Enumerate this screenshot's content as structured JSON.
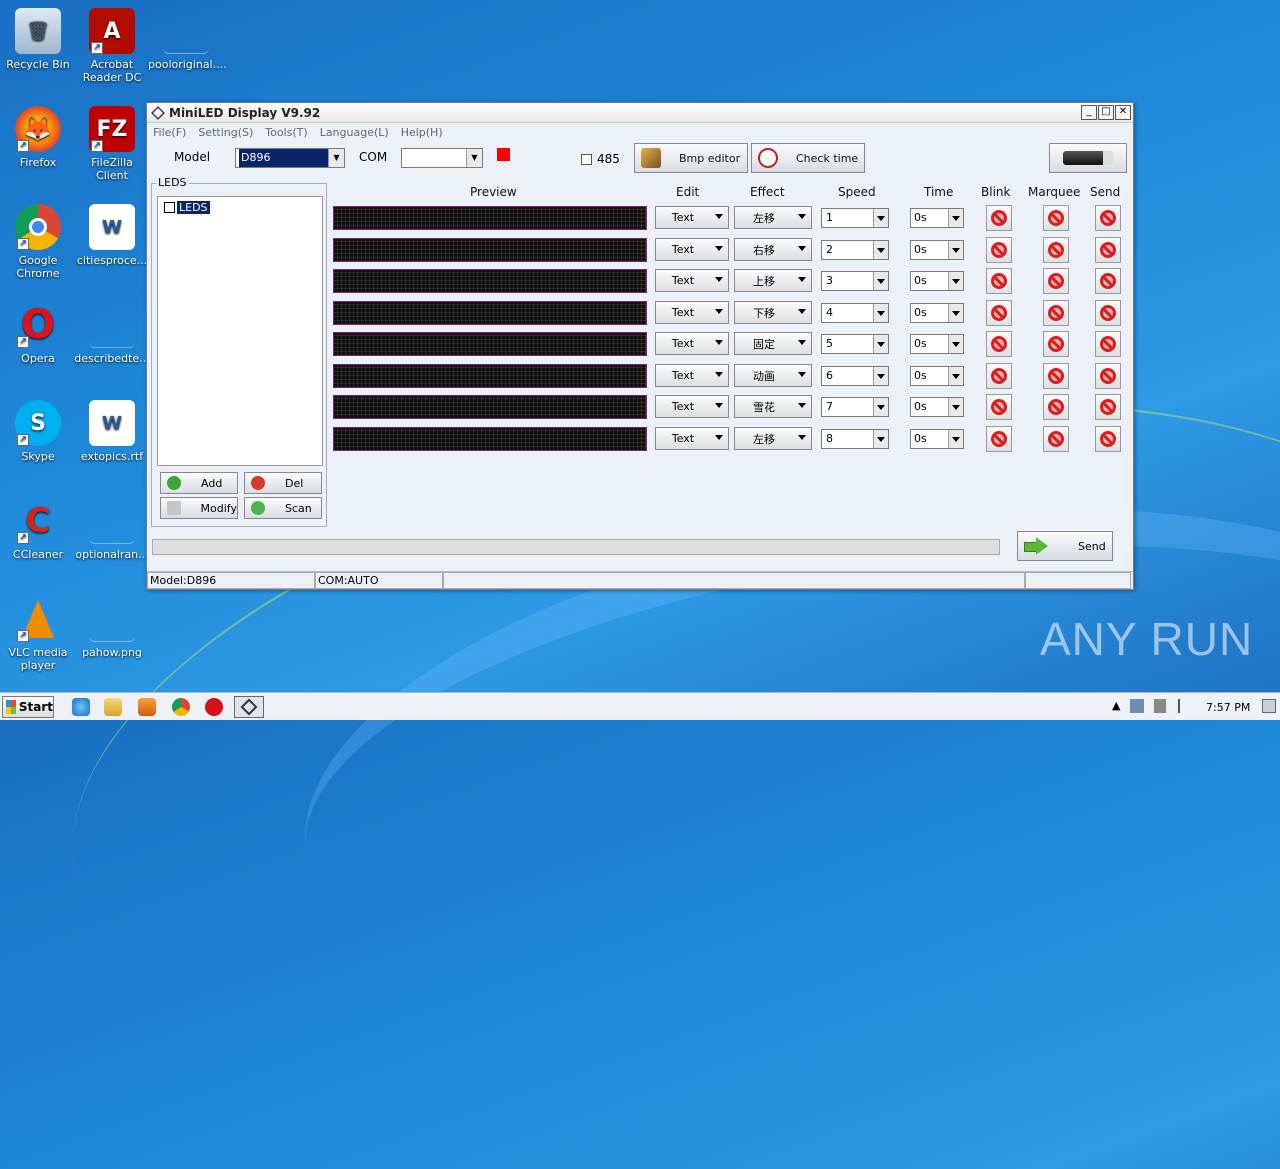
{
  "desktop": {
    "icons": [
      {
        "label": "Recycle Bin"
      },
      {
        "label": "Acrobat Reader DC"
      },
      {
        "label": "pooloriginal...."
      },
      {
        "label": "Firefox"
      },
      {
        "label": "FileZilla Client"
      },
      {
        "label": "Google Chrome"
      },
      {
        "label": "citiesproce..."
      },
      {
        "label": "Opera"
      },
      {
        "label": "describedte..."
      },
      {
        "label": "Skype"
      },
      {
        "label": "extopics.rtf"
      },
      {
        "label": "CCleaner"
      },
      {
        "label": "optionalran..."
      },
      {
        "label": "VLC media player"
      },
      {
        "label": "pahow.png"
      }
    ]
  },
  "window": {
    "title": "MiniLED Display V9.92",
    "menu": [
      "File(F)",
      "Setting(S)",
      "Tools(T)",
      "Language(L)",
      "Help(H)"
    ],
    "toolbar": {
      "model_label": "Model",
      "model_value": "D896",
      "com_label": "COM",
      "com_value": "",
      "chk485_label": "485",
      "bmp_editor": "Bmp editor",
      "check_time": "Check time",
      "status_color": "#ff0000"
    },
    "leds": {
      "legend": "LEDS",
      "tree_item": "LEDS",
      "add": "Add",
      "del": "Del",
      "modify": "Modify",
      "scan": "Scan"
    },
    "headers": {
      "preview": "Preview",
      "edit": "Edit",
      "effect": "Effect",
      "speed": "Speed",
      "time": "Time",
      "blink": "Blink",
      "marquee": "Marquee",
      "send": "Send"
    },
    "rows": [
      {
        "edit": "Text",
        "effect": "左移",
        "speed": "1",
        "time": "0s"
      },
      {
        "edit": "Text",
        "effect": "右移",
        "speed": "2",
        "time": "0s"
      },
      {
        "edit": "Text",
        "effect": "上移",
        "speed": "3",
        "time": "0s"
      },
      {
        "edit": "Text",
        "effect": "下移",
        "speed": "4",
        "time": "0s"
      },
      {
        "edit": "Text",
        "effect": "固定",
        "speed": "5",
        "time": "0s"
      },
      {
        "edit": "Text",
        "effect": "动画",
        "speed": "6",
        "time": "0s"
      },
      {
        "edit": "Text",
        "effect": "雪花",
        "speed": "7",
        "time": "0s"
      },
      {
        "edit": "Text",
        "effect": "左移",
        "speed": "8",
        "time": "0s"
      }
    ],
    "send_button": "Send",
    "status": {
      "model": "Model:D896",
      "com": "COM:AUTO"
    }
  },
  "taskbar": {
    "start": "Start",
    "clock": "7:57 PM"
  },
  "watermark": "ANY RUN"
}
